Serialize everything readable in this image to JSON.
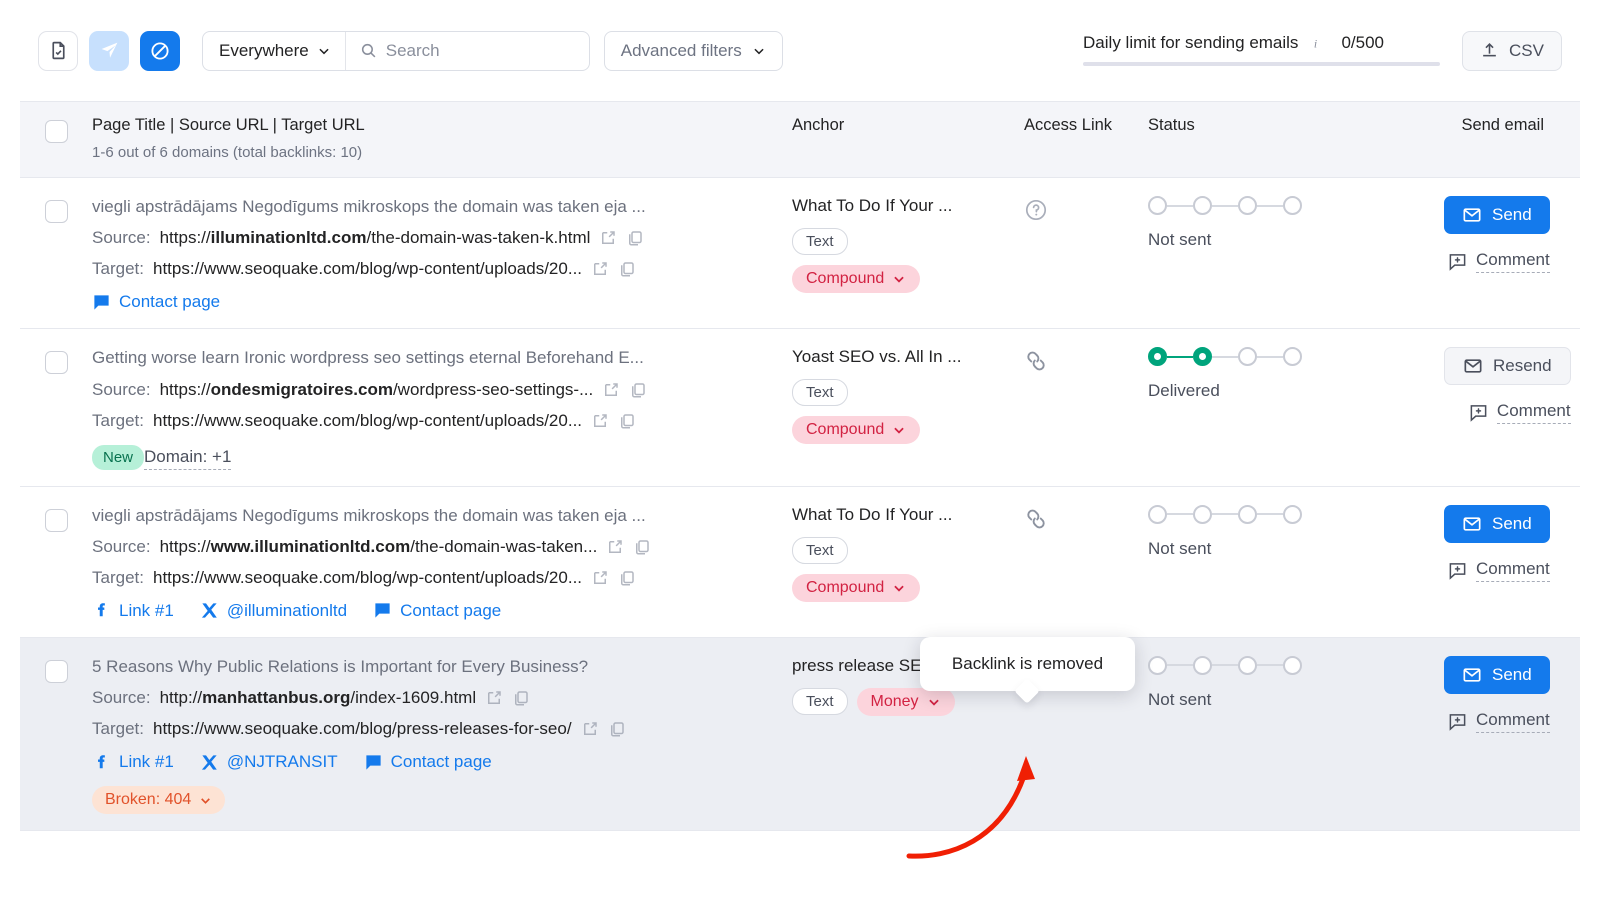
{
  "toolbar": {
    "icons": [
      {
        "name": "document-check-icon",
        "state": "inactive"
      },
      {
        "name": "paper-plane-icon",
        "state": "soft"
      },
      {
        "name": "blocked-icon",
        "state": "active"
      }
    ],
    "scope_select": {
      "value": "Everywhere"
    },
    "search": {
      "placeholder": "Search",
      "value": ""
    },
    "advanced_filters_label": "Advanced filters",
    "daily_limit_label": "Daily limit for sending emails",
    "daily_limit_count": "0/500",
    "csv_label": "CSV",
    "accent_color": "#147aec"
  },
  "table": {
    "headers": {
      "main": "Page Title | Source URL | Target URL",
      "main_sub": "1-6 out of 6 domains (total backlinks: 10)",
      "anchor": "Anchor",
      "access": "Access Link",
      "status": "Status",
      "send": "Send email"
    },
    "rows": [
      {
        "title": "viegli apstrādājams Negodīgums mikroskops the domain was taken eja ...",
        "source_label": "Source:",
        "source_pre": "https://",
        "source_domain": "illuminationltd.com",
        "source_post": "/the-domain-was-taken-k.html",
        "target_label": "Target:",
        "target_pre": "https://",
        "target_domain": "",
        "target_post": "www.seoquake.com/blog/wp-content/uploads/20...",
        "social": [
          {
            "icon": "comment-bubble-icon",
            "label": "Contact page"
          }
        ],
        "badge_new": "",
        "domain_more": "",
        "broken": "",
        "anchor": "What To Do If Your ...",
        "anchor_chips": [
          {
            "type": "outline",
            "label": "Text"
          },
          {
            "type": "red",
            "label": "Compound"
          }
        ],
        "chips_stacked": true,
        "access_icon": "question-circle-icon",
        "status_filled": 0,
        "status_label": "Not sent",
        "send_button": {
          "label": "Send",
          "style": "primary"
        },
        "comment_label": "Comment",
        "highlight": false
      },
      {
        "title": "Getting worse learn Ironic wordpress seo settings eternal Beforehand E...",
        "source_label": "Source:",
        "source_pre": "https://",
        "source_domain": "ondesmigratoires.com",
        "source_post": "/wordpress-seo-settings-...",
        "target_label": "Target:",
        "target_pre": "https://",
        "target_domain": "",
        "target_post": "www.seoquake.com/blog/wp-content/uploads/20...",
        "social": [],
        "badge_new": "New",
        "domain_more": "Domain: +1",
        "broken": "",
        "anchor": "Yoast SEO vs. All In ...",
        "anchor_chips": [
          {
            "type": "outline",
            "label": "Text"
          },
          {
            "type": "red",
            "label": "Compound"
          }
        ],
        "chips_stacked": true,
        "access_icon": "broken-chain-link-icon",
        "status_filled": 2,
        "status_label": "Delivered",
        "send_button": {
          "label": "Resend",
          "style": "secondary"
        },
        "comment_label": "Comment",
        "highlight": false
      },
      {
        "title": "viegli apstrādājams Negodīgums mikroskops the domain was taken eja ...",
        "source_label": "Source:",
        "source_pre": "https://",
        "source_domain": "www.illuminationltd.com",
        "source_post": "/the-domain-was-taken...",
        "target_label": "Target:",
        "target_pre": "https://",
        "target_domain": "",
        "target_post": "www.seoquake.com/blog/wp-content/uploads/20...",
        "social": [
          {
            "icon": "facebook-icon",
            "label": "Link #1"
          },
          {
            "icon": "x-twitter-icon",
            "label": "@illuminationltd"
          },
          {
            "icon": "comment-bubble-icon",
            "label": "Contact page"
          }
        ],
        "badge_new": "",
        "domain_more": "",
        "broken": "",
        "anchor": "What To Do If Your ...",
        "anchor_chips": [
          {
            "type": "outline",
            "label": "Text"
          },
          {
            "type": "red",
            "label": "Compound"
          }
        ],
        "chips_stacked": true,
        "access_icon": "broken-chain-link-icon",
        "status_filled": 0,
        "status_label": "Not sent",
        "send_button": {
          "label": "Send",
          "style": "primary"
        },
        "comment_label": "Comment",
        "highlight": false
      },
      {
        "title": "5 Reasons Why Public Relations is Important for Every Business?",
        "source_label": "Source:",
        "source_pre": "http://",
        "source_domain": "manhattanbus.org",
        "source_post": "/index-1609.html",
        "target_label": "Target:",
        "target_pre": "https://",
        "target_domain": "",
        "target_post": "www.seoquake.com/blog/press-releases-for-seo/",
        "social": [
          {
            "icon": "facebook-icon",
            "label": "Link #1"
          },
          {
            "icon": "x-twitter-icon",
            "label": "@NJTRANSIT"
          },
          {
            "icon": "comment-bubble-icon",
            "label": "Contact page"
          }
        ],
        "badge_new": "",
        "domain_more": "",
        "broken": "Broken: 404",
        "anchor": "press release SEO",
        "anchor_chips": [
          {
            "type": "outline",
            "label": "Text"
          },
          {
            "type": "red",
            "label": "Money"
          }
        ],
        "chips_stacked": false,
        "access_icon": "broken-chain-link-icon",
        "status_filled": 0,
        "status_label": "Not sent",
        "send_button": {
          "label": "Send",
          "style": "primary"
        },
        "comment_label": "Comment",
        "highlight": true
      }
    ]
  },
  "tooltip": {
    "text": "Backlink is removed"
  },
  "annotation": {
    "arrow_color": "#f01f04"
  }
}
